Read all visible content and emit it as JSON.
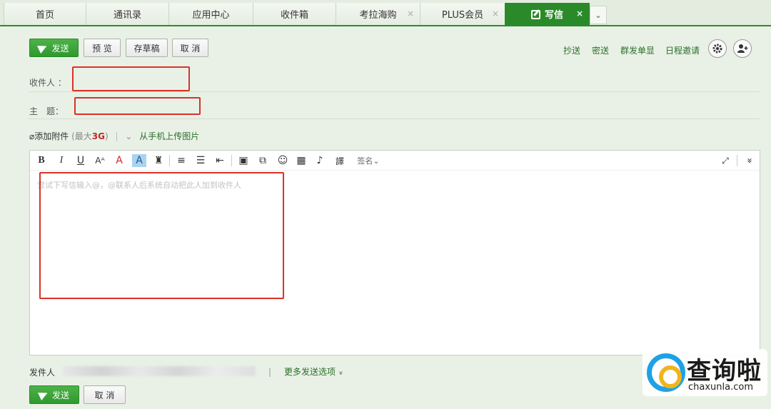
{
  "tabs": [
    {
      "label": "首页",
      "closable": false,
      "active": false
    },
    {
      "label": "通讯录",
      "closable": false,
      "active": false
    },
    {
      "label": "应用中心",
      "closable": false,
      "active": false
    },
    {
      "label": "收件箱",
      "closable": false,
      "active": false
    },
    {
      "label": "考拉海购",
      "closable": true,
      "active": false
    },
    {
      "label": "PLUS会员",
      "closable": true,
      "active": false
    },
    {
      "label": "写信",
      "closable": true,
      "active": true
    }
  ],
  "tab_close_glyph": "×",
  "tab_more_glyph": "⌄",
  "actions": {
    "send": "发送",
    "preview": "预 览",
    "save_draft": "存草稿",
    "cancel": "取 消"
  },
  "header_links": {
    "cc": "抄送",
    "bcc": "密送",
    "mass_send": "群发单显",
    "schedule": "日程邀请"
  },
  "fields": {
    "recipient_label": "收件人 ：",
    "subject_label": "主　题：",
    "recipient_value": "",
    "subject_value": ""
  },
  "attach": {
    "add_attachment": "添加附件",
    "max_open": "(最大",
    "max_size": "3G",
    "max_close": ")",
    "upload_phone": "从手机上传图片"
  },
  "editor": {
    "placeholder": "尝试下写信输入@，@联系人后系统自动把此人加到收件人",
    "signature_label": "签名",
    "toolbar_glyphs": {
      "bold": "B",
      "italic": "I",
      "underline": "U",
      "font_size": "Aᴬ",
      "font_color": "A",
      "bg_color": "A",
      "format_brush": "♜",
      "align": "≡",
      "list": "☰",
      "indent": "⇤",
      "image": "▣",
      "screenshot": "⧉",
      "emoji": "☺",
      "calendar": "▦",
      "mic": "♪",
      "translate": "譯",
      "expand": "⤢",
      "collapse": "»"
    }
  },
  "footer": {
    "sender_label": "发件人",
    "more_options": "更多发送选项",
    "more_options_glyph": "»"
  },
  "watermark": {
    "name": "查询啦",
    "url": "chaxunla.com"
  },
  "colors": {
    "brand_green": "#2a8a29",
    "highlight_red": "#d9322a",
    "link_green": "#2b6e2a"
  }
}
